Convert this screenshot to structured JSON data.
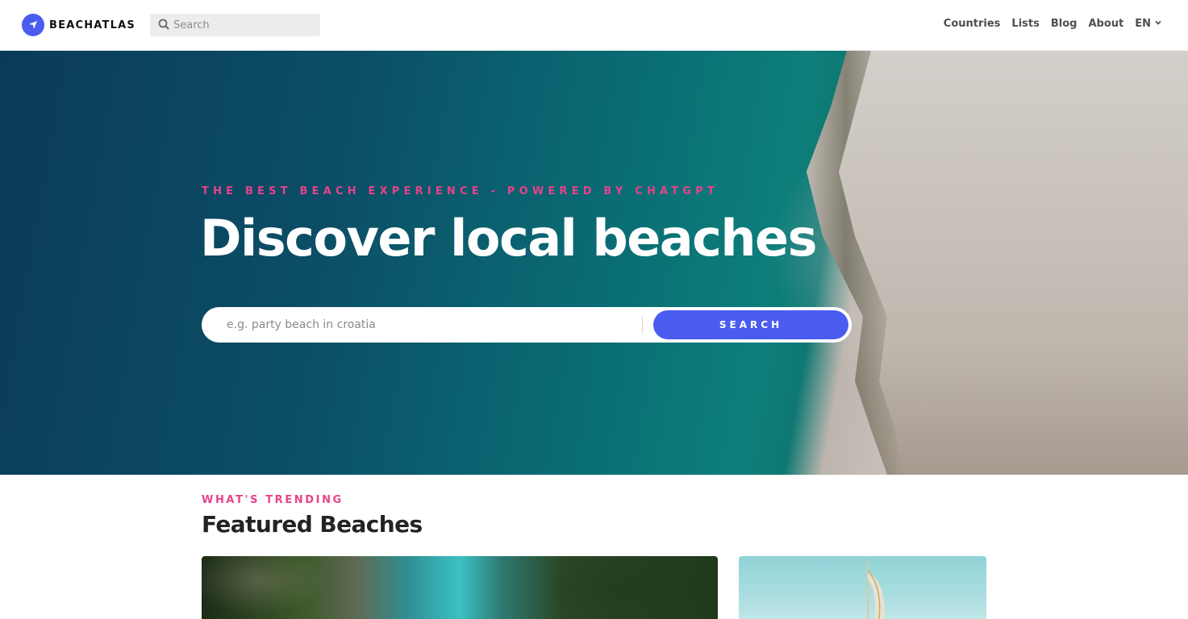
{
  "header": {
    "brand": "BEACHATLAS",
    "search_placeholder": "Search",
    "nav": {
      "countries": "Countries",
      "lists": "Lists",
      "blog": "Blog",
      "about": "About",
      "language": "EN"
    }
  },
  "hero": {
    "kicker": "THE BEST BEACH EXPERIENCE - POWERED BY CHATGPT",
    "title": "Discover local beaches",
    "search_placeholder": "e.g. party beach in croatia",
    "search_button": "SEARCH"
  },
  "featured": {
    "kicker": "WHAT'S TRENDING",
    "title": "Featured Beaches"
  },
  "colors": {
    "accent": "#4a5cf0",
    "kicker": "#e8428a"
  },
  "icons": {
    "logo": "compass-icon",
    "search": "search-icon",
    "language": "chevron-down-icon"
  }
}
